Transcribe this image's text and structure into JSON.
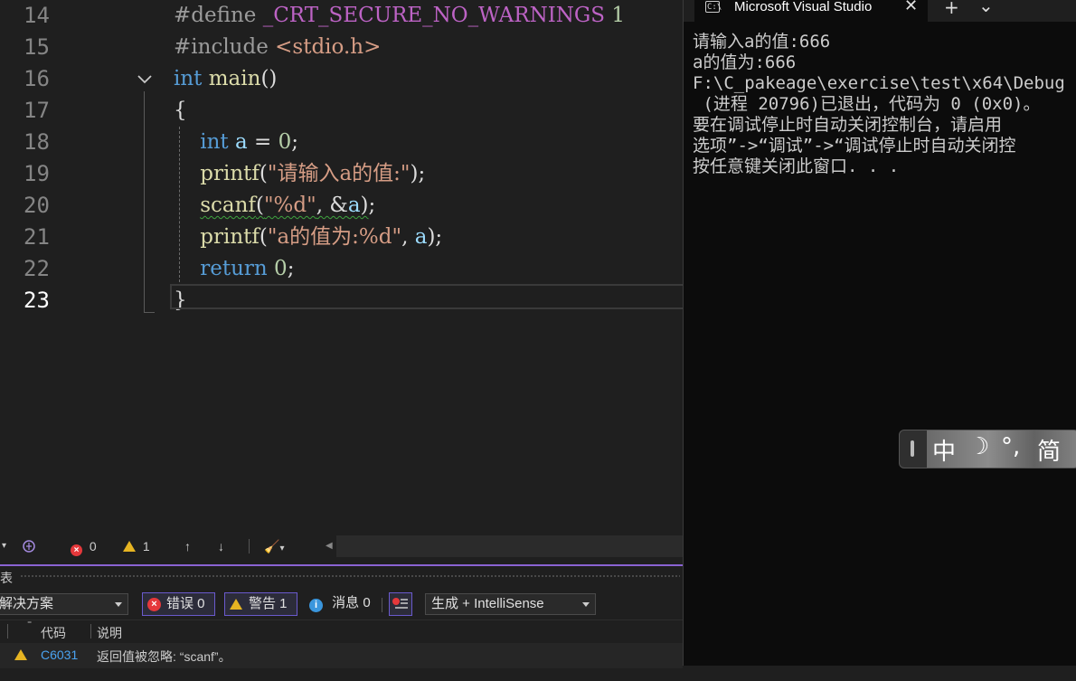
{
  "editor": {
    "lines": [
      {
        "n": "14",
        "tokens": [
          {
            "t": "#define ",
            "c": "pre"
          },
          {
            "t": "_CRT_SECURE_NO_WARNINGS",
            "c": "macro"
          },
          {
            "t": " 1",
            "c": "num"
          }
        ]
      },
      {
        "n": "15",
        "tokens": [
          {
            "t": "#include ",
            "c": "pre"
          },
          {
            "t": "<stdio.h>",
            "c": "inc"
          }
        ]
      },
      {
        "n": "16",
        "tokens": [
          {
            "t": "int",
            "c": "kw"
          },
          {
            "t": " ",
            "c": ""
          },
          {
            "t": "main",
            "c": "fn"
          },
          {
            "t": "()",
            "c": ""
          }
        ]
      },
      {
        "n": "17",
        "tokens": [
          {
            "t": "{",
            "c": ""
          }
        ]
      },
      {
        "n": "18",
        "tokens": [
          {
            "t": "    ",
            "c": ""
          },
          {
            "t": "int",
            "c": "kw"
          },
          {
            "t": " ",
            "c": ""
          },
          {
            "t": "a",
            "c": "var"
          },
          {
            "t": " = ",
            "c": ""
          },
          {
            "t": "0",
            "c": "num"
          },
          {
            "t": ";",
            "c": ""
          }
        ]
      },
      {
        "n": "19",
        "tokens": [
          {
            "t": "    ",
            "c": ""
          },
          {
            "t": "printf",
            "c": "fn"
          },
          {
            "t": "(",
            "c": ""
          },
          {
            "t": "\"请输入a的值:\"",
            "c": "str"
          },
          {
            "t": ");",
            "c": ""
          }
        ]
      },
      {
        "n": "20",
        "tokens": [
          {
            "t": "    ",
            "c": ""
          },
          {
            "t": "scanf",
            "c": "fn squig"
          },
          {
            "t": "(",
            "c": "squig"
          },
          {
            "t": "\"%d\"",
            "c": "str squig"
          },
          {
            "t": ", &",
            "c": "squig"
          },
          {
            "t": "a",
            "c": "var squig"
          },
          {
            "t": ")",
            "c": "squig"
          },
          {
            "t": ";",
            "c": ""
          }
        ]
      },
      {
        "n": "21",
        "tokens": [
          {
            "t": "    ",
            "c": ""
          },
          {
            "t": "printf",
            "c": "fn"
          },
          {
            "t": "(",
            "c": ""
          },
          {
            "t": "\"a的值为:%d\"",
            "c": "str"
          },
          {
            "t": ", ",
            "c": ""
          },
          {
            "t": "a",
            "c": "var"
          },
          {
            "t": ");",
            "c": ""
          }
        ]
      },
      {
        "n": "22",
        "tokens": [
          {
            "t": "    ",
            "c": ""
          },
          {
            "t": "return",
            "c": "kw"
          },
          {
            "t": " ",
            "c": ""
          },
          {
            "t": "0",
            "c": "num"
          },
          {
            "t": ";",
            "c": ""
          }
        ]
      },
      {
        "n": "23",
        "tokens": [
          {
            "t": "}",
            "c": ""
          }
        ]
      }
    ],
    "current_line": "23"
  },
  "status": {
    "errors": "0",
    "warnings": "1"
  },
  "error_list": {
    "title_fragment": "表",
    "scope": "解决方案",
    "errors_label": "错误 0",
    "warnings_label": "警告 1",
    "messages_label": "消息 0",
    "build_filter": "生成 + IntelliSense",
    "col_code": "代码",
    "col_desc": "说明",
    "rows": [
      {
        "code": "C6031",
        "desc": "返回值被忽略: “scanf”。"
      }
    ]
  },
  "console": {
    "tab_title": "Microsoft Visual Studio",
    "tab_icon": "C:\\",
    "close": "✕",
    "new_tab": "+",
    "dropdown": "⌄",
    "output_lines": [
      "请输入a的值:666",
      "a的值为:666",
      "F:\\C_pakeage\\exercise\\test\\x64\\Debug",
      " (进程 20796)已退出，代码为 0 (0x0)。",
      "要在调试停止时自动关闭控制台，请启用",
      "选项”->“调试”->“调试停止时自动关闭控",
      "按任意键关闭此窗口. . ."
    ]
  },
  "ime": {
    "mode": "中",
    "moon": "☽",
    "punct": "°,",
    "script": "简"
  }
}
